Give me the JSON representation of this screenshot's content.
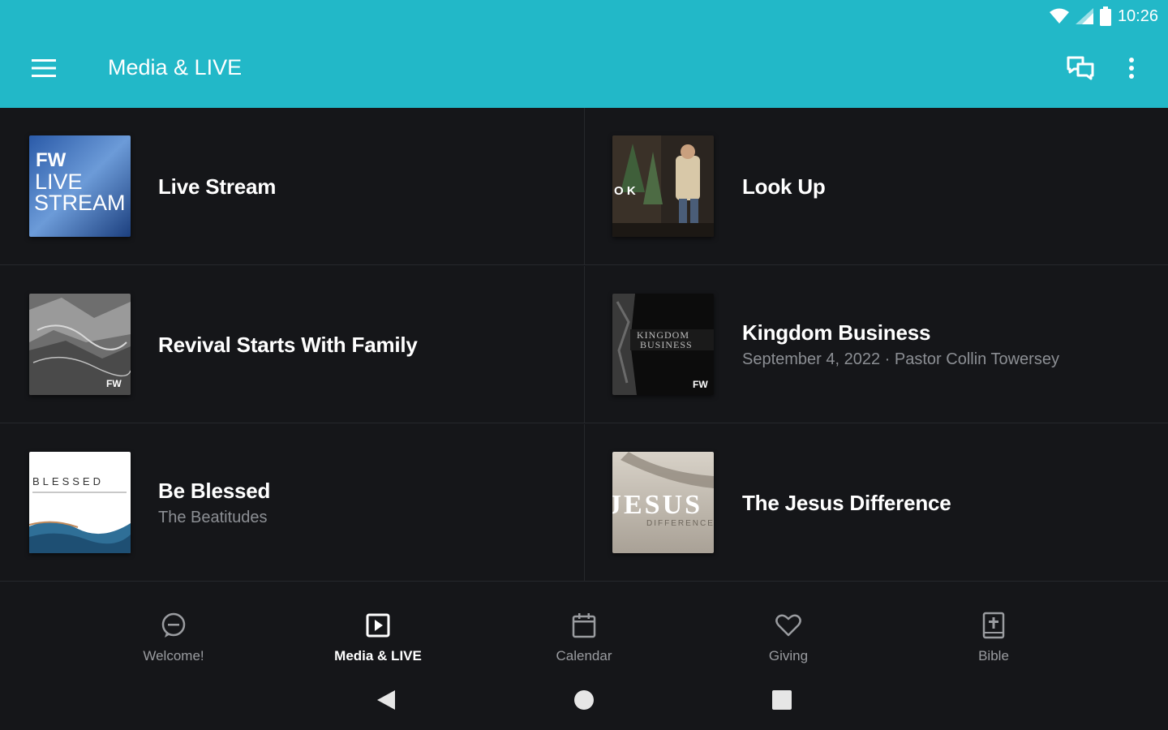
{
  "status_bar": {
    "time": "10:26",
    "icons": [
      "wifi-icon",
      "signal-icon",
      "battery-icon"
    ]
  },
  "toolbar": {
    "title": "Media & LIVE",
    "menu_icon": "hamburger-icon",
    "chat_icon": "chat-icon",
    "more_icon": "more-vert-icon"
  },
  "colors": {
    "app_bar": "#22b8c8",
    "background": "#151619",
    "subtitle": "#8c8f94"
  },
  "media_items": [
    {
      "title": "Live Stream",
      "subtitle": "",
      "thumb_text": [
        "FW",
        "LIVE",
        "STREAM"
      ]
    },
    {
      "title": "Look Up",
      "subtitle": "",
      "thumb_text": [
        "O K"
      ]
    },
    {
      "title": "Revival Starts With Family",
      "subtitle": "",
      "thumb_text": [
        "FW"
      ]
    },
    {
      "title": "Kingdom Business",
      "subtitle": "September 4, 2022 · Pastor Collin Towersey",
      "thumb_text": [
        "KINGDOM",
        "BUSINESS",
        "FW"
      ]
    },
    {
      "title": "Be Blessed",
      "subtitle": "The Beatitudes",
      "thumb_text": [
        "BLESSED"
      ]
    },
    {
      "title": "The Jesus Difference",
      "subtitle": "",
      "thumb_text": [
        "JESUS",
        "DIFFERENCE"
      ]
    }
  ],
  "bottom_nav": [
    {
      "label": "Welcome!",
      "icon": "chat-bubble-icon",
      "active": false
    },
    {
      "label": "Media & LIVE",
      "icon": "play-box-icon",
      "active": true
    },
    {
      "label": "Calendar",
      "icon": "calendar-icon",
      "active": false
    },
    {
      "label": "Giving",
      "icon": "heart-icon",
      "active": false
    },
    {
      "label": "Bible",
      "icon": "bible-icon",
      "active": false
    }
  ],
  "system_nav": [
    "back-icon",
    "home-icon",
    "recents-icon"
  ]
}
